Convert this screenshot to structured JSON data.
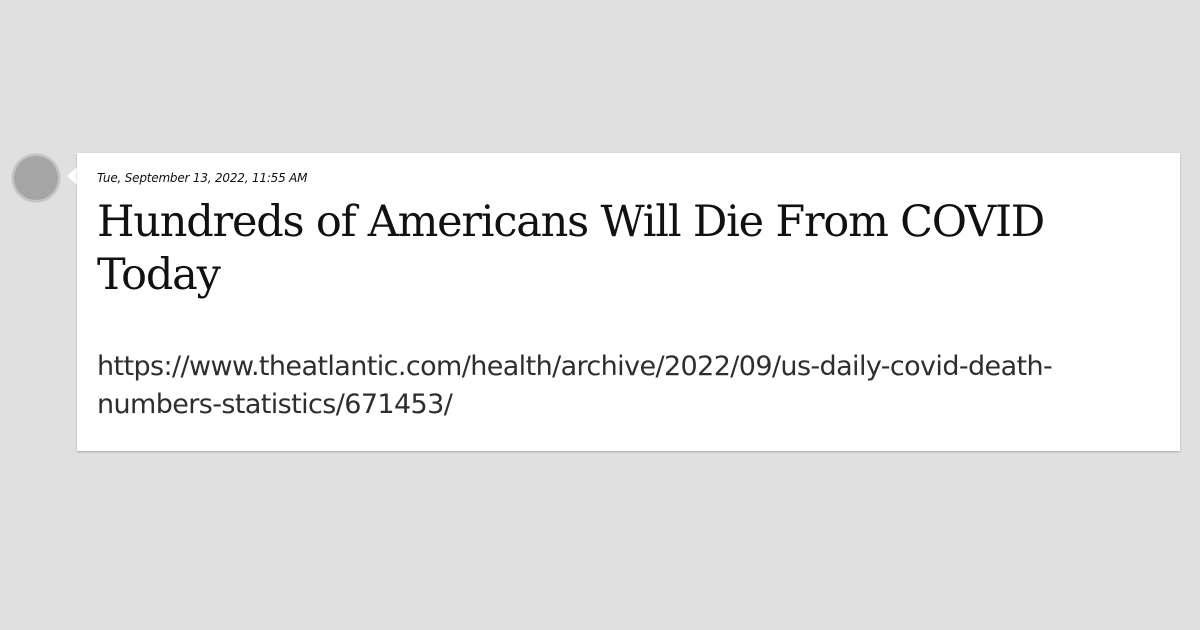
{
  "post": {
    "timestamp": "Tue, September 13, 2022, 11:55 AM",
    "title": "Hundreds of Americans Will Die From COVID Today",
    "url_line1": "https://www.theatlantic.com/health/archive/2022/09/us-daily-covid-death-",
    "url_line2": "numbers-statistics/671453/"
  },
  "colors": {
    "background": "#e0e0e0",
    "card": "#ffffff",
    "avatar": "#a6a6a6"
  }
}
